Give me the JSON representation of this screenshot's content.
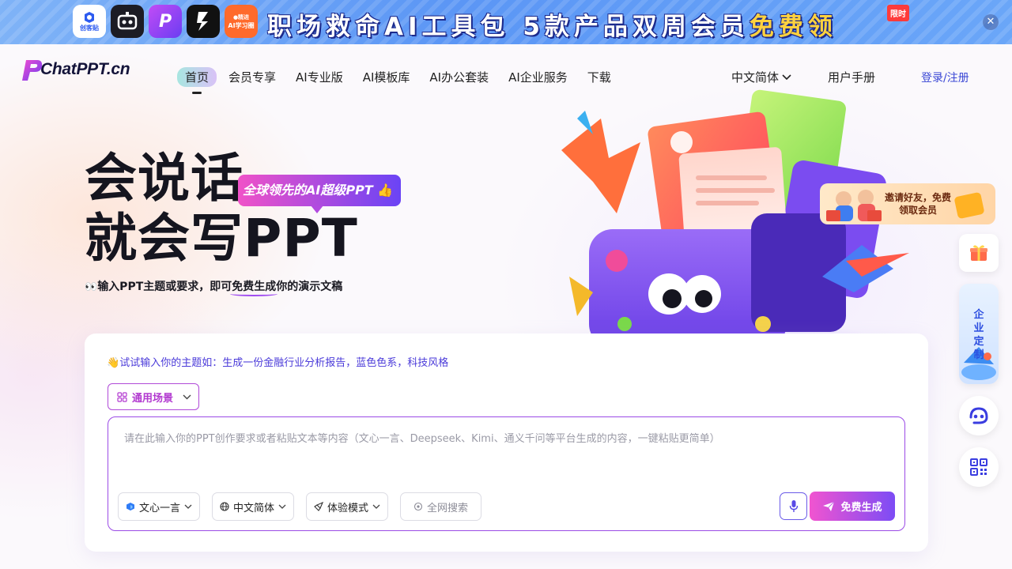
{
  "promo": {
    "apps": [
      {
        "name": "创客贴",
        "icon": "chuangketie-app-icon"
      },
      {
        "name": "",
        "icon": "robot-app-icon"
      },
      {
        "name": "",
        "icon": "p-app-icon"
      },
      {
        "name": "",
        "icon": "slash-app-icon"
      },
      {
        "name": "AI学习圈",
        "icon": "ai-study-app-icon"
      }
    ],
    "text_main": "职场救命AI工具包 5款产品双周会员",
    "text_highlight": "免费领",
    "limited_badge": "限时",
    "close_icon": "close-icon"
  },
  "nav": {
    "logo_text": "ChatPPT.cn",
    "menu": [
      {
        "label": "首页",
        "active": true
      },
      {
        "label": "会员专享",
        "active": false
      },
      {
        "label": "AI专业版",
        "active": false
      },
      {
        "label": "AI模板库",
        "active": false
      },
      {
        "label": "AI办公套装",
        "active": false
      },
      {
        "label": "AI企业服务",
        "active": false
      },
      {
        "label": "下载",
        "active": false
      }
    ],
    "language": "中文简体",
    "user_manual": "用户手册",
    "login": "登录/注册"
  },
  "hero": {
    "title_line1": "会说话",
    "title_line2": "就会写PPT",
    "badge": "全球领先的AI超级PPT",
    "subtitle_prefix": "输入PPT主题或要求，即可",
    "subtitle_free": "免费生成",
    "subtitle_suffix": "你的演示文稿"
  },
  "card": {
    "hint_prefix": "试试输入你的主题如：",
    "hint_example": "生成一份金融行业分析报告，蓝色色系，科技风格",
    "scene_label": "通用场景",
    "input_placeholder": "请在此输入你的PPT创作要求或者粘贴文本等内容（文心一言、Deepseek、Kimi、通义千问等平台生成的内容，一键粘贴更简单）",
    "tools": {
      "model": "文心一言",
      "language": "中文简体",
      "mode": "体验模式",
      "web_search": "全网搜索"
    },
    "generate_label": "免费生成"
  },
  "sidebar": {
    "invite_text": "邀请好友，免费领取会员",
    "enterprise_label": "企业定制"
  },
  "colors": {
    "accent_purple": "#7c4cf5",
    "accent_pink": "#f154d0",
    "link_blue": "#3a47d5"
  }
}
